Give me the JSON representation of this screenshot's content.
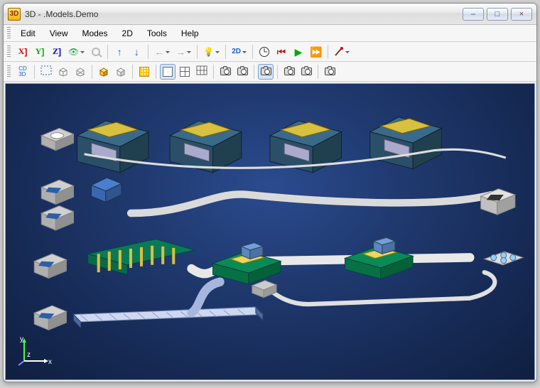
{
  "window": {
    "title": "3D - .Models.Demo",
    "minimize": "–",
    "maximize": "□",
    "close": "×"
  },
  "menu": {
    "edit": "Edit",
    "view": "View",
    "modes": "Modes",
    "twoD": "2D",
    "tools": "Tools",
    "help": "Help"
  },
  "toolbar1": {
    "axis_x": "X",
    "axis_y": "Y",
    "axis_z": "Z",
    "label_2d": "2D"
  },
  "toolbar2": {
    "cd3d": "CD\n3D"
  },
  "axis_gizmo": {
    "x": "x",
    "y": "y",
    "z": "z"
  }
}
